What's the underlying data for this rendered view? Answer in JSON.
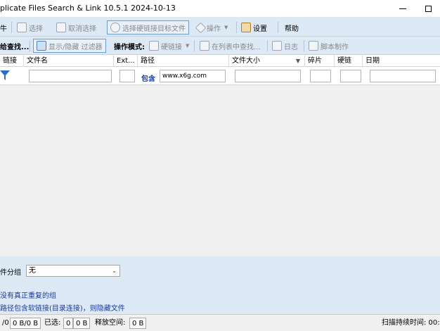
{
  "window": {
    "title": "plicate Files Search & Link 10.5.1 2024-10-13"
  },
  "toolbar1": {
    "item0": "牛",
    "select": "选择",
    "deselect": "取消选择",
    "select_hardlink_target": "选择硬链接目标文件",
    "operate": "操作",
    "settings": "设置",
    "help": "帮助"
  },
  "toolbar2": {
    "search": "给查找...",
    "toggle_filter": "显示/隐藏 过滤器",
    "op_mode_label": "操作模式:",
    "hardlink": "硬链接",
    "find_in_list": "在列表中查找...",
    "log": "日志",
    "script": "脚本制作"
  },
  "grid": {
    "columns": [
      "链接",
      "文件名",
      "Ext...",
      "路径",
      "文件大小",
      "碎片",
      "硬链",
      "日期"
    ],
    "filter_contains": "包含",
    "filter_path_value": "www.x6g.com"
  },
  "bottom": {
    "group_label": "件分组",
    "group_selected": "无",
    "message1": "没有真正重复的组",
    "message2": "路径包含软链接(目录连接)，则隐藏文件"
  },
  "status": {
    "s0": "/0",
    "s1": "0 B/0 B",
    "selected_label": "已选:",
    "s2": "0",
    "s3": "0 B",
    "free_label": "释放空间:",
    "s4": "0 B",
    "scan_time": "扫描持续时间: 00:"
  },
  "colors": {
    "panel_bg": "#dde9f5",
    "link_blue": "#1a3a9e",
    "frame_blue": "#6a9bd1"
  }
}
